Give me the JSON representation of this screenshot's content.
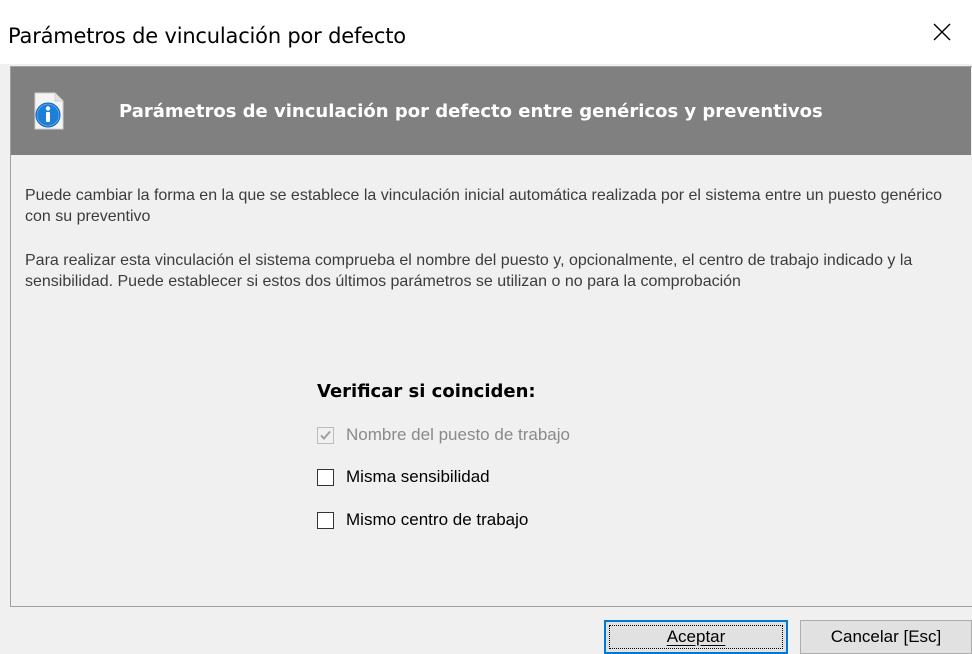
{
  "window": {
    "title": "Parámetros de vinculación por defecto",
    "close_icon": "close-icon"
  },
  "header": {
    "icon": "info-icon",
    "title": "Parámetros de vinculación por defecto entre genéricos y preventivos"
  },
  "body": {
    "paragraph1": "Puede cambiar la forma en la que se establece la vinculación inicial automática realizada por el sistema entre un puesto genérico con su preventivo",
    "paragraph2": "Para realizar esta vinculación el sistema comprueba el nombre del puesto y, opcionalmente, el centro de trabajo indicado y la sensibilidad. Puede establecer si estos dos últimos parámetros se utilizan o no para la comprobación"
  },
  "verify": {
    "title": "Verificar si coinciden:",
    "options": [
      {
        "label": "Nombre del puesto de trabajo",
        "checked": true,
        "enabled": false
      },
      {
        "label": "Misma sensibilidad",
        "checked": false,
        "enabled": true
      },
      {
        "label": "Mismo centro de trabajo",
        "checked": false,
        "enabled": true
      }
    ]
  },
  "buttons": {
    "accept_label": "Aceptar",
    "cancel_label": "Cancelar [Esc]"
  },
  "colors": {
    "header_band": "#808080",
    "focus_border": "#0078d7",
    "icon_blue": "#1e7fd8"
  }
}
